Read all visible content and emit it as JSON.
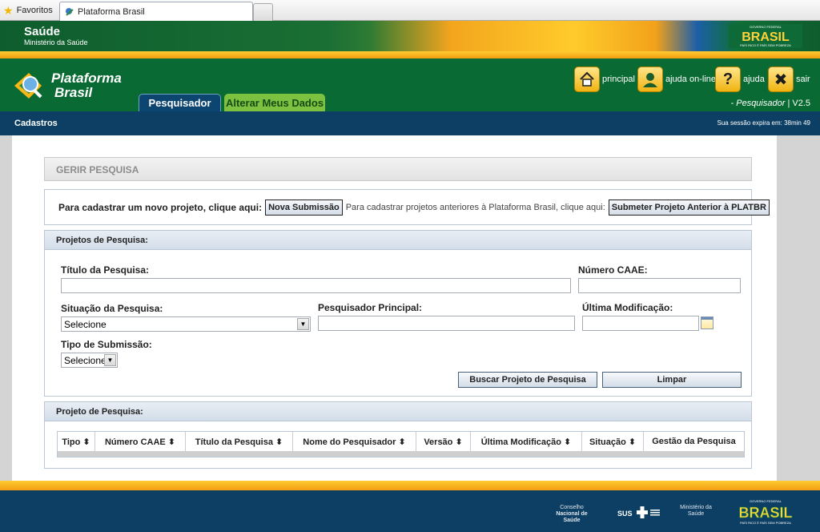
{
  "browser": {
    "favorites_label": "Favoritos",
    "tab_title": "Plataforma Brasil"
  },
  "banner": {
    "title": "Saúde",
    "subtitle": "Ministério da Saúde",
    "brasil_logo_text": "BRASIL",
    "brasil_slogan": "PAÍS RICO É PAÍS SEM POBREZA",
    "brasil_header": "GOVERNO FEDERAL"
  },
  "header": {
    "logo_line1": "Plataforma",
    "logo_line2": "Brasil",
    "tabs": [
      {
        "label": "Pesquisador"
      },
      {
        "label": "Alterar Meus Dados"
      }
    ],
    "actions": [
      {
        "label": "principal",
        "icon": "home-icon"
      },
      {
        "label": "ajuda on-line",
        "icon": "person-icon"
      },
      {
        "label": "ajuda",
        "icon": "help-icon"
      },
      {
        "label": "sair",
        "icon": "close-icon"
      }
    ],
    "role": "- Pesquisador",
    "version": "| V2.5"
  },
  "navstrip": {
    "section": "Cadastros",
    "session": "Sua sessão expira em: 38min 49"
  },
  "page": {
    "title": "GERIR PESQUISA",
    "cadastro": {
      "prompt_new": "Para cadastrar um novo projeto, clique aqui:",
      "new_button": "Nova Submissão",
      "prompt_old": "Para cadastrar projetos anteriores à Plataforma Brasil, clique aqui:",
      "old_button": "Submeter Projeto Anterior à PLATBR"
    },
    "search": {
      "section_title": "Projetos de Pesquisa:",
      "titulo_label": "Título da Pesquisa:",
      "titulo_value": "",
      "caae_label": "Número CAAE:",
      "caae_value": "",
      "situacao_label": "Situação da Pesquisa:",
      "situacao_value": "Selecione",
      "pesquisador_label": "Pesquisador Principal:",
      "pesquisador_value": "",
      "modificacao_label": "Última Modificação:",
      "modificacao_value": "",
      "tipo_label": "Tipo de Submissão:",
      "tipo_value": "Selecione",
      "buscar_button": "Buscar Projeto de Pesquisa",
      "limpar_button": "Limpar"
    },
    "results": {
      "section_title": "Projeto de Pesquisa:",
      "columns": [
        "Tipo ⬍",
        "Número CAAE ⬍",
        "Título da Pesquisa ⬍",
        "Nome do Pesquisador ⬍",
        "Versão ⬍",
        "Última Modificação ⬍",
        "Situação ⬍",
        "Gestão da Pesquisa"
      ]
    }
  },
  "footer": {
    "cns_line1": "Conselho",
    "cns_line2": "Nacional de Saúde",
    "sus": "SUS",
    "ms_line1": "Ministério da",
    "ms_line2": "Saúde",
    "brasil_logo_text": "BRASIL",
    "brasil_slogan": "PAÍS RICO É PAÍS SEM POBREZA",
    "brasil_header": "GOVERNO FEDERAL"
  },
  "colors": {
    "header_green": "#096b33",
    "nav_blue": "#0c3f63",
    "accent_orange": "#f29d12",
    "alter_tab_green": "#7cc240"
  }
}
